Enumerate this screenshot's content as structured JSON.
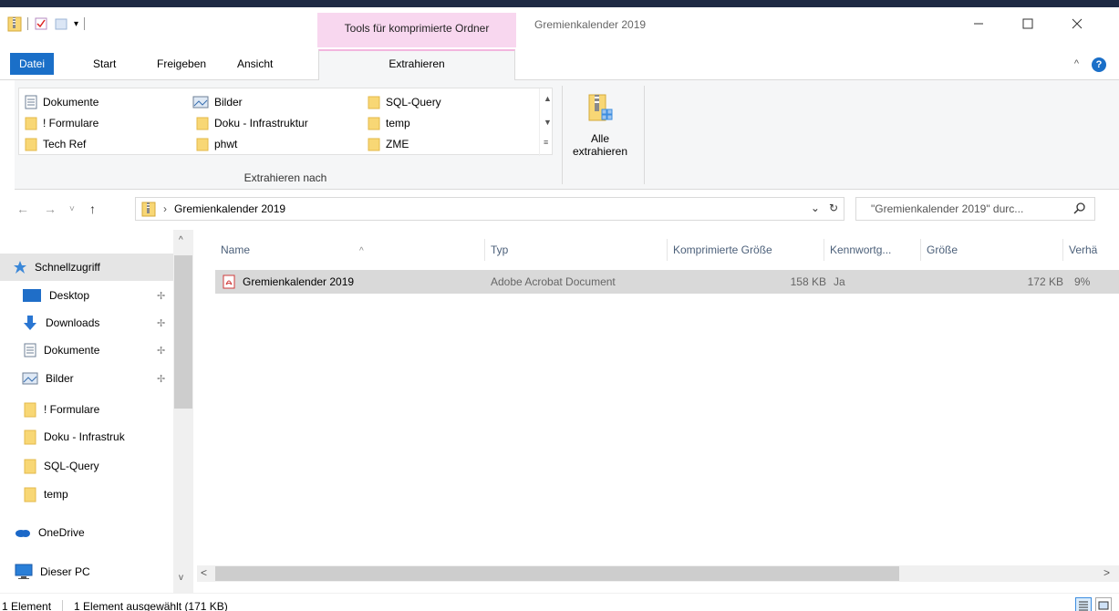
{
  "window": {
    "title": "Gremienkalender 2019",
    "contextual_header": "Tools für komprimierte Ordner",
    "controls": [
      "—",
      "☐",
      "✕"
    ]
  },
  "ribbon": {
    "tabs": [
      "Datei",
      "Start",
      "Freigeben",
      "Ansicht",
      "Extrahieren"
    ],
    "active_tab": "Extrahieren",
    "gallery_items": [
      {
        "label": "Dokumente",
        "icon": "documents-icon"
      },
      {
        "label": "! Formulare",
        "icon": "folder-icon"
      },
      {
        "label": "Tech Ref",
        "icon": "folder-icon"
      },
      {
        "label": "Bilder",
        "icon": "pictures-icon"
      },
      {
        "label": "Doku - Infrastruktur",
        "icon": "folder-icon"
      },
      {
        "label": "phwt",
        "icon": "folder-icon"
      },
      {
        "label": "SQL-Query",
        "icon": "folder-icon"
      },
      {
        "label": "temp",
        "icon": "folder-icon"
      },
      {
        "label": "ZME",
        "icon": "folder-icon"
      }
    ],
    "group_label": "Extrahieren nach",
    "extract_all_line1": "Alle",
    "extract_all_line2": "extrahieren"
  },
  "address": {
    "path": "Gremienkalender 2019",
    "search_placeholder": "\"Gremienkalender 2019\" durc..."
  },
  "nav": {
    "quick_access": "Schnellzugriff",
    "items": [
      {
        "label": "Desktop",
        "icon": "desktop-icon",
        "pinned": true
      },
      {
        "label": "Downloads",
        "icon": "download-icon",
        "pinned": true
      },
      {
        "label": "Dokumente",
        "icon": "documents-icon",
        "pinned": true
      },
      {
        "label": "Bilder",
        "icon": "pictures-icon",
        "pinned": true
      },
      {
        "label": "! Formulare",
        "icon": "folder-icon",
        "pinned": false
      },
      {
        "label": "Doku - Infrastruk",
        "icon": "folder-icon",
        "pinned": false
      },
      {
        "label": "SQL-Query",
        "icon": "folder-icon",
        "pinned": false
      },
      {
        "label": "temp",
        "icon": "folder-icon",
        "pinned": false
      }
    ],
    "onedrive": "OneDrive",
    "this_pc": "Dieser PC"
  },
  "filelist": {
    "columns": [
      "Name",
      "Typ",
      "Komprimierte Größe",
      "Kennwortg...",
      "Größe",
      "Verhä"
    ],
    "rows": [
      {
        "name": "Gremienkalender 2019",
        "type": "Adobe Acrobat Document",
        "compressed": "158 KB",
        "password": "Ja",
        "size": "172 KB",
        "ratio": "9%"
      }
    ]
  },
  "status": {
    "count": "1 Element",
    "selected": "1 Element ausgewählt (171 KB)"
  },
  "colors": {
    "accent": "#1a6fc8",
    "contextual": "#f8d7ef",
    "folder": "#f8d775",
    "selection": "#d9d9d9"
  }
}
